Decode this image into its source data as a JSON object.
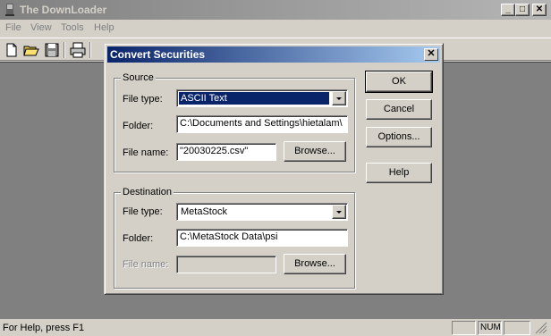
{
  "app": {
    "title": "The DownLoader",
    "caption_buttons": {
      "minimize": "_",
      "maximize": "□",
      "close": "✕"
    },
    "menu": [
      "File",
      "View",
      "Tools",
      "Help"
    ],
    "status": {
      "text": "For Help, press F1",
      "num": "NUM"
    }
  },
  "dialog": {
    "title": "Convert Securities",
    "close_glyph": "✕",
    "source": {
      "label": "Source",
      "file_type_label": "File type:",
      "file_type_value": "ASCII Text",
      "folder_label": "Folder:",
      "folder_value": "C:\\Documents and Settings\\hietalam\\",
      "file_name_label": "File name:",
      "file_name_value": "\"20030225.csv\"",
      "browse_label": "Browse..."
    },
    "destination": {
      "label": "Destination",
      "file_type_label": "File type:",
      "file_type_value": "MetaStock",
      "folder_label": "Folder:",
      "folder_value": "C:\\MetaStock Data\\psi",
      "file_name_label": "File name:",
      "file_name_value": "",
      "browse_label": "Browse..."
    },
    "buttons": {
      "ok": "OK",
      "cancel": "Cancel",
      "options": "Options...",
      "help": "Help"
    }
  },
  "colors": {
    "face": "#d4d0c8",
    "active_title": "#0a246a",
    "inactive_title": "#808080",
    "workspace": "#808080",
    "selection": "#0a246a"
  }
}
